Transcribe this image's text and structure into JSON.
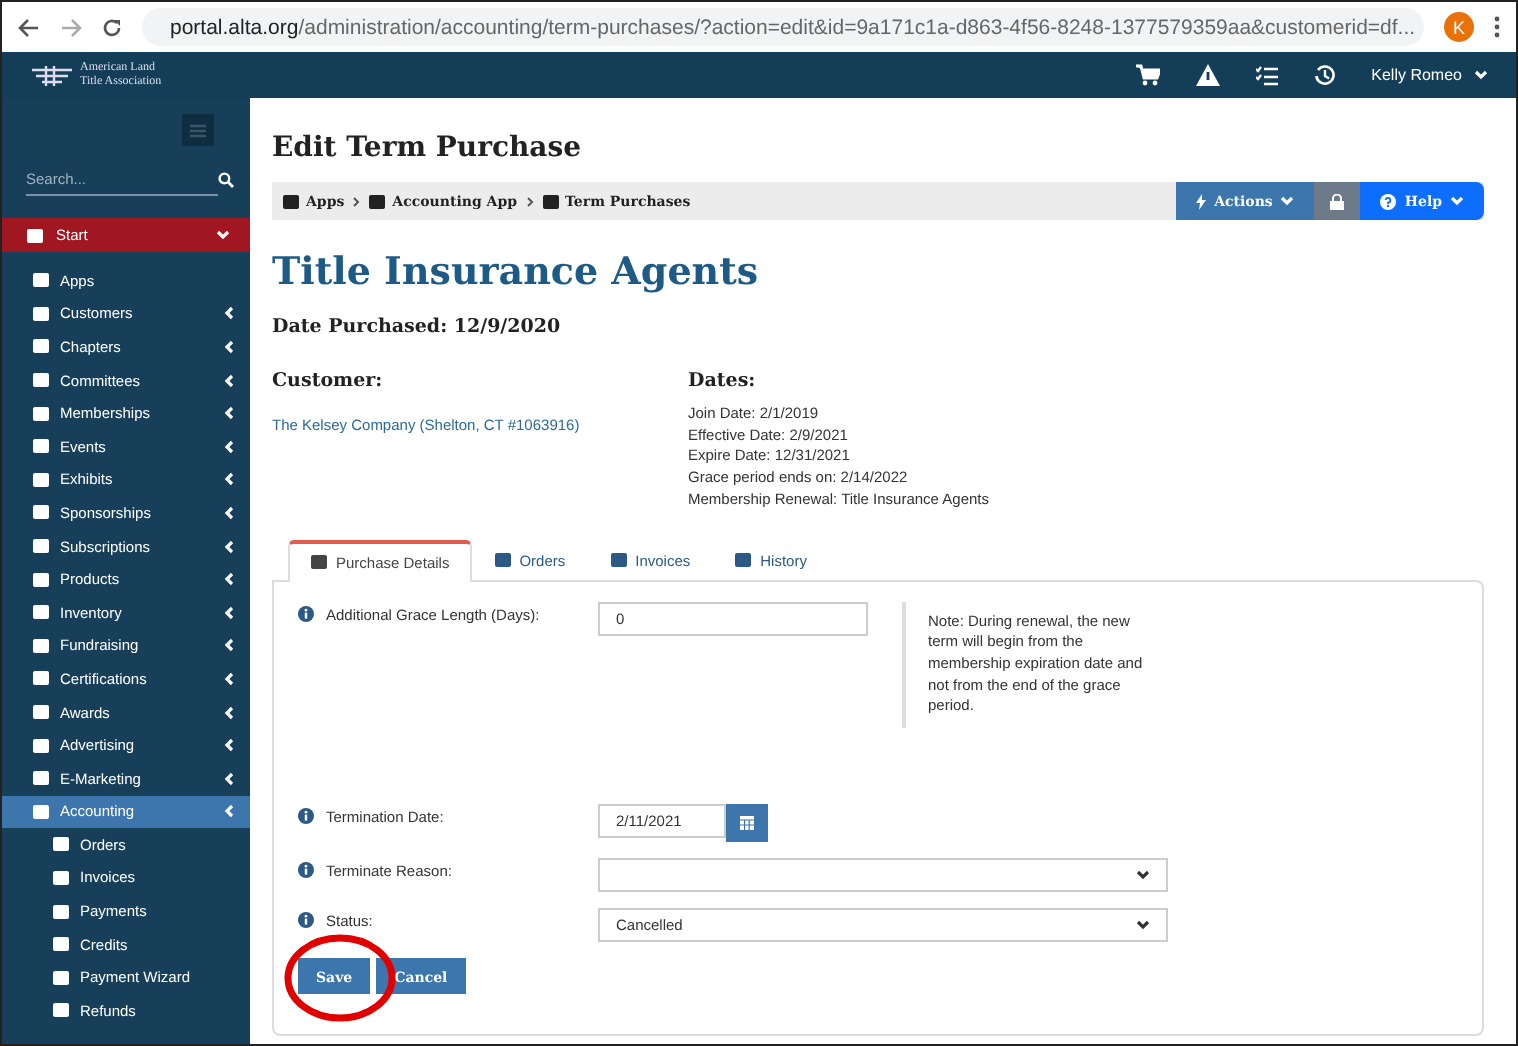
{
  "browser": {
    "url_host": "portal.alta.org",
    "url_path": "/administration/accounting/term-purchases/?action=edit&id=9a171c1a-d863-4f56-8248-1377579359aa&customerid=df...",
    "avatar": "K"
  },
  "logo": {
    "line_1": "American Land",
    "line_2": "Title Association"
  },
  "topbar": {
    "user": "Kelly Romeo"
  },
  "sidebar": {
    "search_placeholder": "Search...",
    "start": "Start",
    "items": [
      {
        "label": "Apps",
        "chevron": false,
        "selected": false
      },
      {
        "label": "Customers",
        "chevron": true,
        "selected": false
      },
      {
        "label": "Chapters",
        "chevron": true,
        "selected": false
      },
      {
        "label": "Committees",
        "chevron": true,
        "selected": false
      },
      {
        "label": "Memberships",
        "chevron": true,
        "selected": false
      },
      {
        "label": "Events",
        "chevron": true,
        "selected": false
      },
      {
        "label": "Exhibits",
        "chevron": true,
        "selected": false
      },
      {
        "label": "Sponsorships",
        "chevron": true,
        "selected": false
      },
      {
        "label": "Subscriptions",
        "chevron": true,
        "selected": false
      },
      {
        "label": "Products",
        "chevron": true,
        "selected": false
      },
      {
        "label": "Inventory",
        "chevron": true,
        "selected": false
      },
      {
        "label": "Fundraising",
        "chevron": true,
        "selected": false
      },
      {
        "label": "Certifications",
        "chevron": true,
        "selected": false
      },
      {
        "label": "Awards",
        "chevron": true,
        "selected": false
      },
      {
        "label": "Advertising",
        "chevron": true,
        "selected": false
      },
      {
        "label": "E-Marketing",
        "chevron": true,
        "selected": false
      },
      {
        "label": "Accounting",
        "chevron": true,
        "selected": true,
        "children": [
          {
            "label": "Orders"
          },
          {
            "label": "Invoices"
          },
          {
            "label": "Payments"
          },
          {
            "label": "Credits"
          },
          {
            "label": "Payment Wizard"
          },
          {
            "label": "Refunds"
          }
        ]
      }
    ]
  },
  "page": {
    "title": "Edit Term Purchase",
    "breadcrumb": [
      "Apps",
      "Accounting App",
      "Term Purchases"
    ],
    "actions": "Actions",
    "help": "Help",
    "heading": "Title Insurance Agents",
    "date_purchased": "Date Purchased: 12/9/2020",
    "customer_label": "Customer:",
    "customer": "The Kelsey Company (Shelton, CT #1063916)",
    "dates_label": "Dates:",
    "dates": [
      "Join Date: 2/1/2019",
      "Effective Date: 2/9/2021",
      "Expire Date: 12/31/2021",
      "Grace period ends on: 2/14/2022",
      "Membership Renewal: Title Insurance Agents"
    ]
  },
  "tabs": [
    {
      "label": "Purchase Details",
      "selected": true
    },
    {
      "label": "Orders",
      "selected": false
    },
    {
      "label": "Invoices",
      "selected": false
    },
    {
      "label": "History",
      "selected": false
    }
  ],
  "form": [
    {
      "kind": "text",
      "label": "Additional Grace Length (Days):",
      "value": "0",
      "note": "Note: During renewal, the new term will begin from the membership expiration date and not from the end of the grace period."
    },
    {
      "kind": "date",
      "label": "Termination Date:",
      "value": "2/11/2021"
    },
    {
      "kind": "select",
      "label": "Terminate Reason:"
    },
    {
      "kind": "select",
      "label": "Status:",
      "value": "Cancelled"
    }
  ],
  "buttons": {
    "save": "Save",
    "cancel": "Cancel"
  },
  "annotation": {
    "circled": true
  }
}
